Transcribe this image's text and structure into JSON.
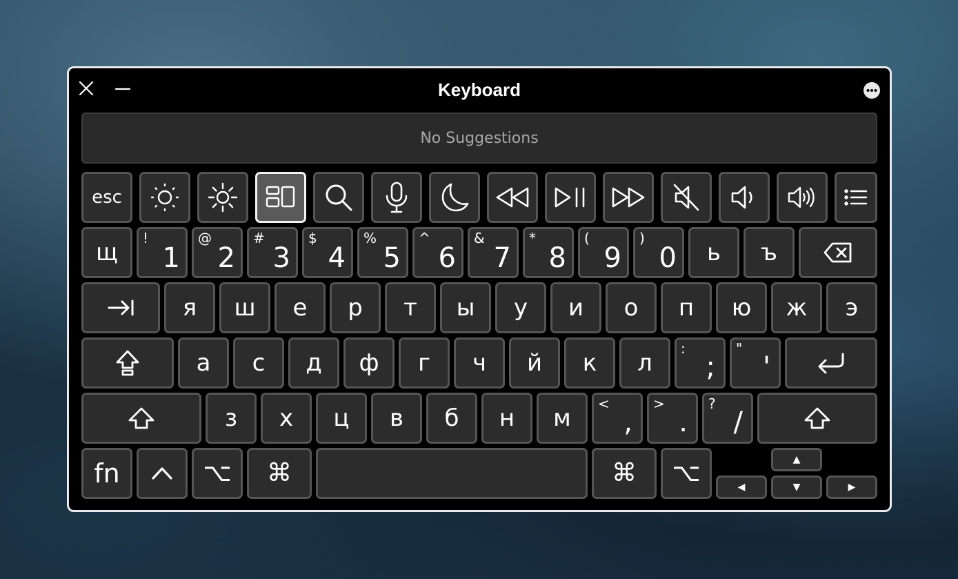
{
  "window": {
    "title": "Keyboard"
  },
  "suggestions": {
    "text": "No Suggestions"
  },
  "icons": {
    "close": "close-icon",
    "minimize": "minimize-icon",
    "more": "more-icon",
    "brightness_down": "brightness-down-icon",
    "brightness_up": "brightness-up-icon",
    "mission_control": "mission-control-icon",
    "search": "search-icon",
    "dictation": "microphone-icon",
    "do_not_disturb": "moon-icon",
    "rewind": "rewind-icon",
    "play_pause": "play-pause-icon",
    "fast_forward": "fast-forward-icon",
    "mute": "mute-icon",
    "volume_down": "volume-down-icon",
    "volume_up": "volume-up-icon",
    "list": "list-icon"
  },
  "function_row": {
    "esc": "esc"
  },
  "number_row": [
    {
      "main": "щ"
    },
    {
      "shift": "!",
      "main": "1"
    },
    {
      "shift": "@",
      "main": "2"
    },
    {
      "shift": "#",
      "main": "3"
    },
    {
      "shift": "$",
      "main": "4"
    },
    {
      "shift": "%",
      "main": "5"
    },
    {
      "shift": "^",
      "main": "6"
    },
    {
      "shift": "&",
      "main": "7"
    },
    {
      "shift": "*",
      "main": "8"
    },
    {
      "shift": "(",
      "main": "9"
    },
    {
      "shift": ")",
      "main": "0"
    },
    {
      "main": "ь"
    },
    {
      "main": "ъ"
    }
  ],
  "top_row": [
    "я",
    "ш",
    "е",
    "р",
    "т",
    "ы",
    "у",
    "и",
    "о",
    "п",
    "ю",
    "ж",
    "э"
  ],
  "home_row": [
    "а",
    "с",
    "д",
    "ф",
    "г",
    "ч",
    "й",
    "к",
    "л"
  ],
  "home_punct": [
    {
      "shift": ":",
      "main": ";"
    },
    {
      "shift": "\"",
      "main": "'"
    }
  ],
  "bottom_row": [
    "з",
    "х",
    "ц",
    "в",
    "б",
    "н",
    "м"
  ],
  "bottom_punct": [
    {
      "shift": "<",
      "main": ","
    },
    {
      "shift": ">",
      "main": "."
    },
    {
      "shift": "?",
      "main": "/"
    }
  ],
  "modifiers": {
    "fn": "fn",
    "control": "^",
    "option": "⌥",
    "command": "⌘"
  },
  "arrows": {
    "up": "▲",
    "down": "▼",
    "left": "◀",
    "right": "▶"
  }
}
